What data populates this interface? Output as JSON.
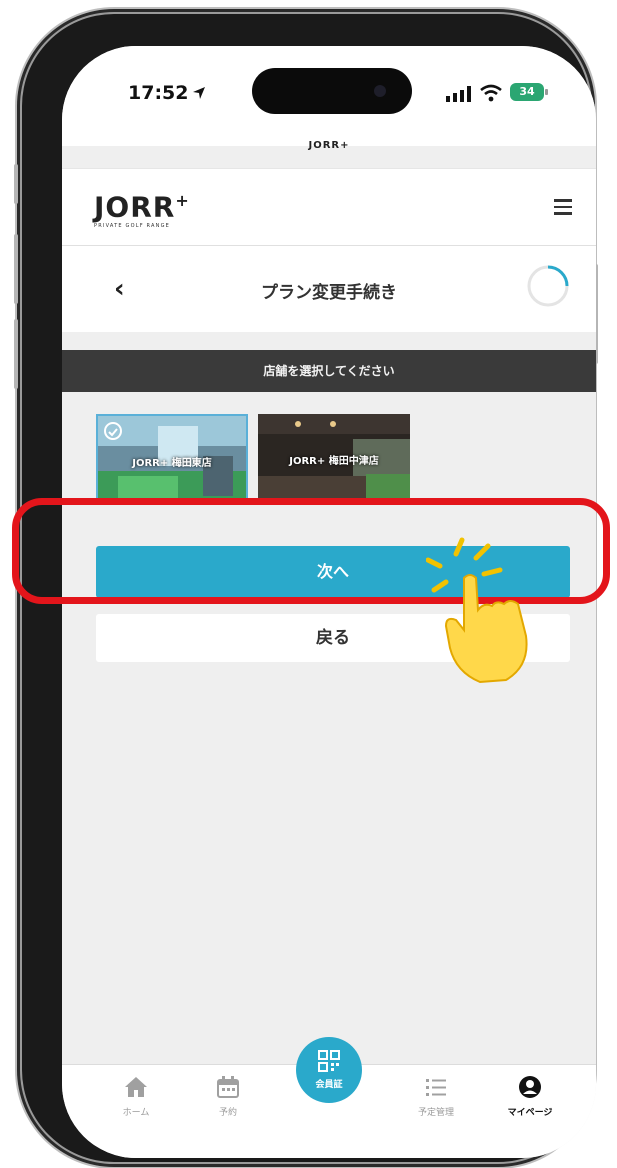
{
  "status_bar": {
    "time": "17:52",
    "battery": "34"
  },
  "browser": {
    "url_title": "JORR+"
  },
  "header": {
    "logo": "JORR",
    "logo_plus": "+",
    "logo_tagline": "PRIVATE GOLF RANGE"
  },
  "page": {
    "title": "プラン変更手続き"
  },
  "banner": {
    "text": "店舗を選択してください"
  },
  "stores": [
    {
      "label": "JORR+ 梅田東店",
      "selected": true
    },
    {
      "label": "JORR+ 梅田中津店",
      "selected": false
    }
  ],
  "buttons": {
    "next": "次へ",
    "back": "戻る"
  },
  "tabbar": {
    "home": "ホーム",
    "reserve": "予約",
    "member_card": "会員証",
    "schedule": "予定管理",
    "mypage": "マイページ"
  },
  "colors": {
    "accent": "#2aa9cb",
    "highlight": "#e3151b",
    "banner": "#3a3a3a"
  }
}
